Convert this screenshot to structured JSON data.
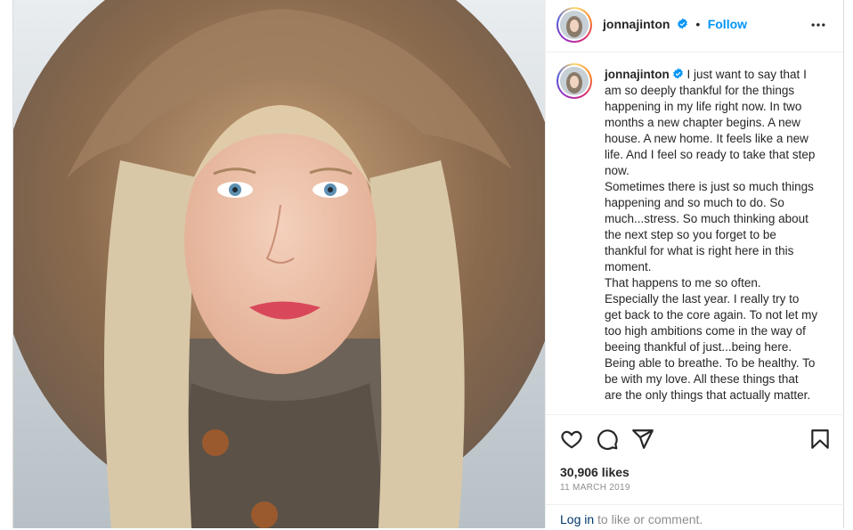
{
  "post": {
    "username": "jonnajinton",
    "separator": "•",
    "follow_label": "Follow",
    "caption": "I just want to say that I am so deeply thankful for the things happening in my life right now. In two months a new chapter begins. A new house. A new home. It feels like a new life. And I feel so ready to take that step now.\nSometimes there is just so much things happening and so much to do. So much...stress. So much thinking about the next step so you forget to be thankful for what is right here in this moment.\nThat happens to me so often. Especially the last year. I really try to get back to the core again. To not let my too high ambitions come in the way of beeing thankful of just...being here. Being able to breathe. To be healthy. To be with my love. All these things that are the only things that actually matter.",
    "likes": "30,906 likes",
    "date": "11 MARCH 2019",
    "login_link": "Log in",
    "login_suffix": " to like or comment."
  },
  "icons": {
    "verified": "verified-badge-icon",
    "more": "more-options-icon",
    "like": "heart-icon",
    "comment": "comment-icon",
    "share": "share-icon",
    "save": "bookmark-icon"
  },
  "colors": {
    "link_blue": "#0095f6",
    "login_blue": "#00376b",
    "text": "#262626",
    "muted": "#8e8e8e"
  }
}
